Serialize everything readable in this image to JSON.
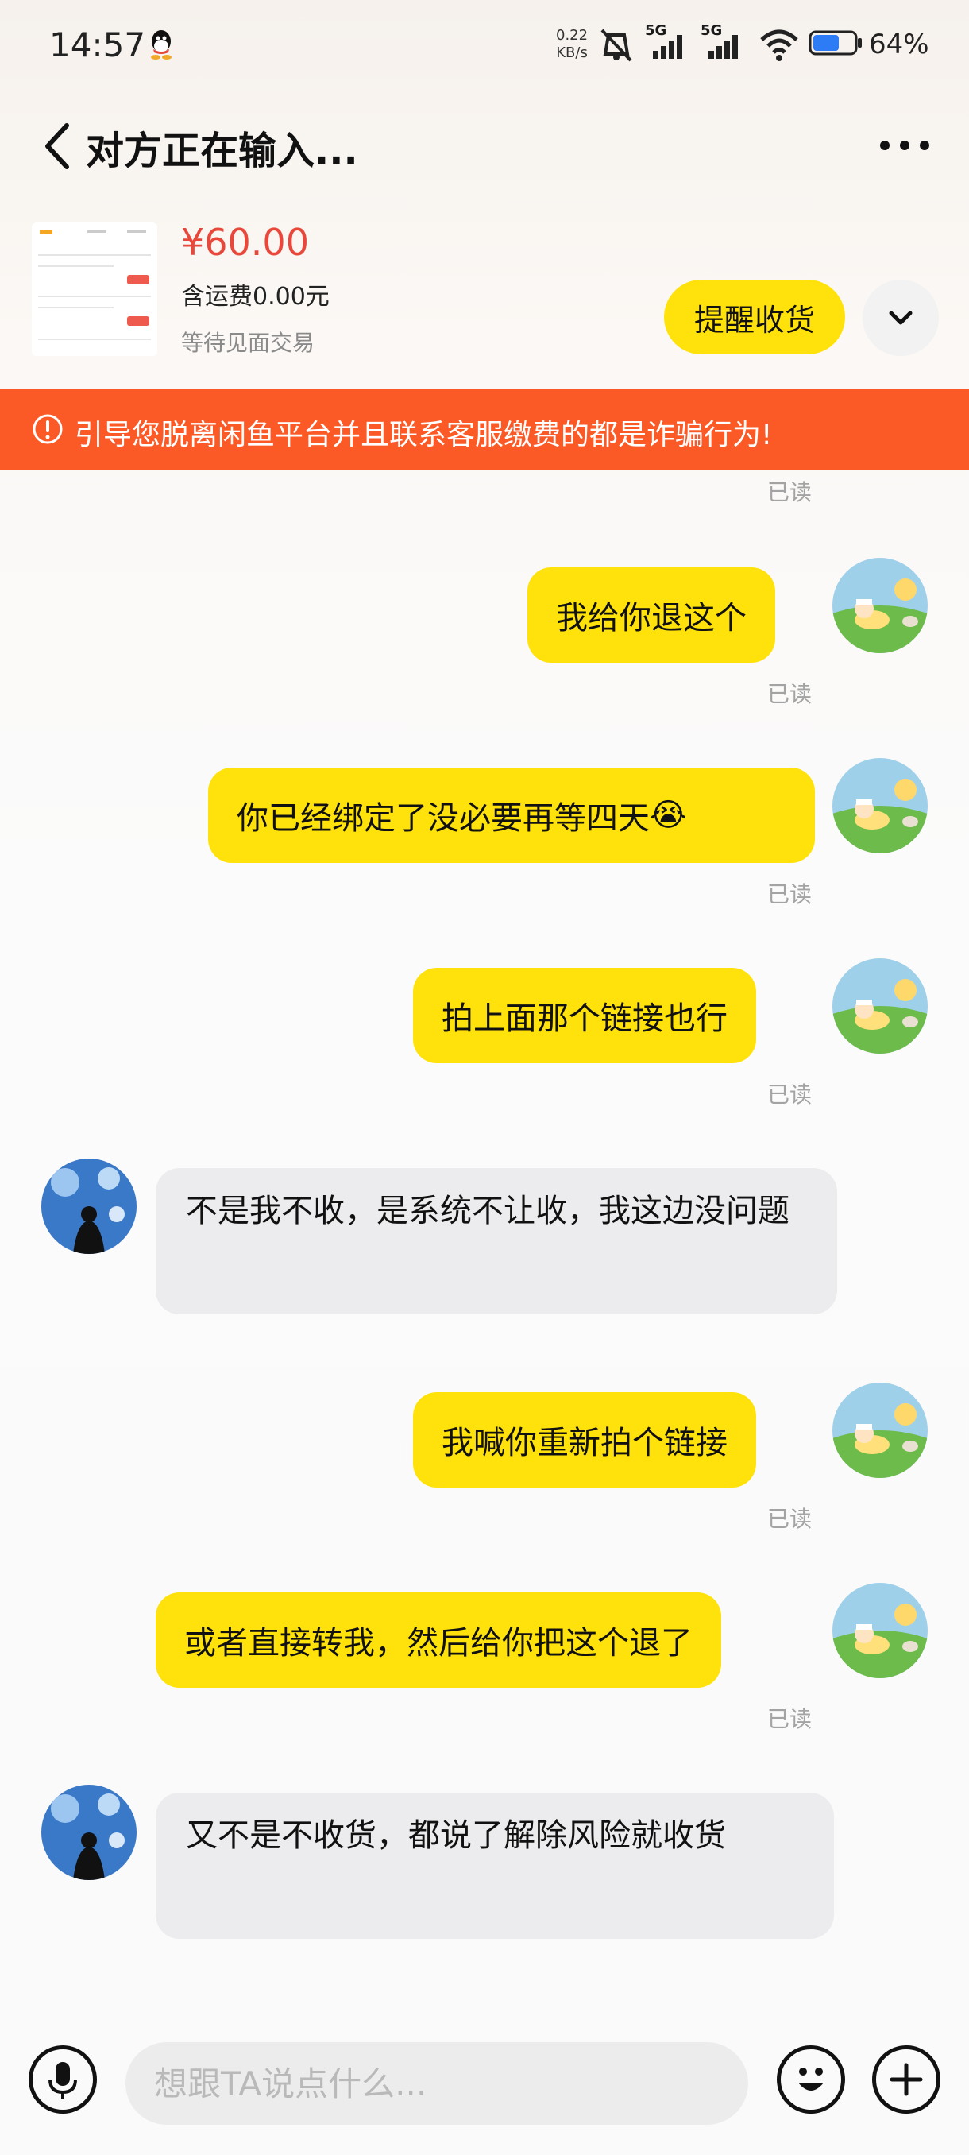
{
  "status_bar": {
    "time": "14:57",
    "net_speed_value": "0.22",
    "net_speed_unit": "KB/s",
    "signal1_label": "5G",
    "signal2_label": "5G",
    "battery_percent": "64%",
    "battery_level": 0.64
  },
  "header": {
    "title": "对方正在输入..."
  },
  "product": {
    "price": "¥60.00",
    "shipping": "含运费0.00元",
    "status": "等待见面交易",
    "remind_button": "提醒收货"
  },
  "warning": {
    "text": "引导您脱离闲鱼平台并且联系客服缴费的都是诈骗行为!"
  },
  "messages": [
    {
      "from": "me",
      "text": "我给你退这个",
      "read": "已读"
    },
    {
      "from": "me",
      "text": "你已经绑定了没必要再等四天",
      "emoji": "😭",
      "read": "已读"
    },
    {
      "from": "me",
      "text": "拍上面那个链接也行",
      "read": "已读"
    },
    {
      "from": "them",
      "text": "不是我不收，是系统不让收，我这边没问题"
    },
    {
      "from": "me",
      "text": "我喊你重新拍个链接",
      "read": "已读"
    },
    {
      "from": "me",
      "text": "或者直接转我，然后给你把这个退了",
      "read": "已读"
    },
    {
      "from": "them",
      "text": "又不是不收货，都说了解除风险就收货"
    }
  ],
  "top_read_label": "已读",
  "input": {
    "placeholder": "想跟TA说点什么..."
  },
  "colors": {
    "accent_yellow": "#ffe20b",
    "warning_orange": "#fb5a27",
    "price_red": "#e8483c"
  },
  "icons": [
    "back-icon",
    "more-icon",
    "chevron-down-icon",
    "mic-icon",
    "emoji-icon",
    "plus-icon",
    "alert-circle-icon"
  ]
}
